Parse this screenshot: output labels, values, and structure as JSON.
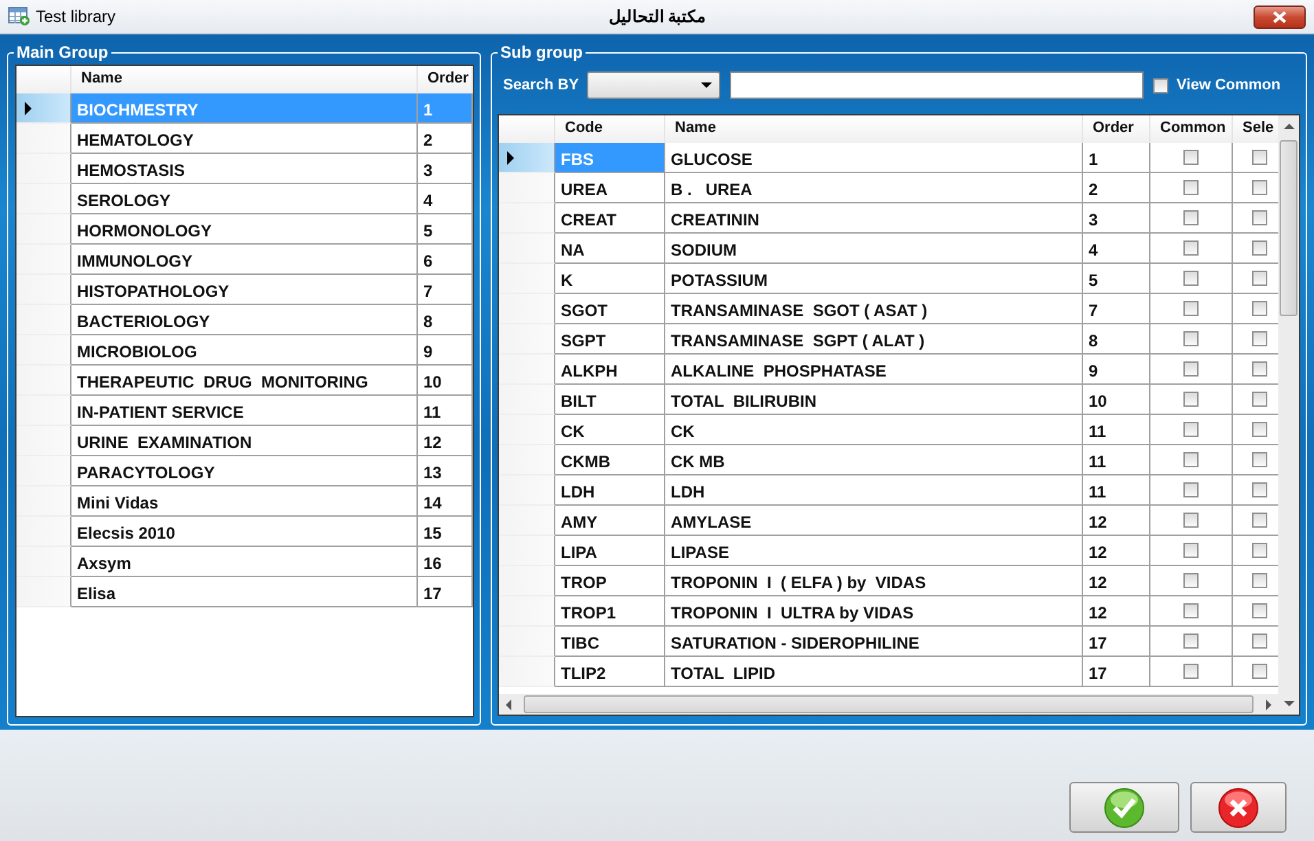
{
  "window": {
    "title": "Test library",
    "caption": "مكتبة التحاليل"
  },
  "main_group": {
    "title": "Main Group",
    "columns": [
      "Name",
      "Order"
    ],
    "rows": [
      {
        "name": "BIOCHMESTRY",
        "order": "1",
        "selected": true
      },
      {
        "name": "HEMATOLOGY",
        "order": "2",
        "selected": false
      },
      {
        "name": "HEMOSTASIS",
        "order": "3",
        "selected": false
      },
      {
        "name": "SEROLOGY",
        "order": "4",
        "selected": false
      },
      {
        "name": "HORMONOLOGY",
        "order": "5",
        "selected": false
      },
      {
        "name": "IMMUNOLOGY",
        "order": "6",
        "selected": false
      },
      {
        "name": "HISTOPATHOLOGY",
        "order": "7",
        "selected": false
      },
      {
        "name": "BACTERIOLOGY",
        "order": "8",
        "selected": false
      },
      {
        "name": "MICROBIOLOG",
        "order": "9",
        "selected": false
      },
      {
        "name": "THERAPEUTIC  DRUG  MONITORING",
        "order": "10",
        "selected": false
      },
      {
        "name": "IN-PATIENT SERVICE",
        "order": "11",
        "selected": false
      },
      {
        "name": "URINE  EXAMINATION",
        "order": "12",
        "selected": false
      },
      {
        "name": "PARACYTOLOGY",
        "order": "13",
        "selected": false
      },
      {
        "name": "Mini Vidas",
        "order": "14",
        "selected": false
      },
      {
        "name": "Elecsis 2010",
        "order": "15",
        "selected": false
      },
      {
        "name": "Axsym",
        "order": "16",
        "selected": false
      },
      {
        "name": "Elisa",
        "order": "17",
        "selected": false
      }
    ]
  },
  "sub_group": {
    "title": "Sub group",
    "search_label": "Search BY",
    "view_common": {
      "label": "View Common",
      "checked": false
    },
    "columns": [
      "Code",
      "Name",
      "Order",
      "Common",
      "Sele"
    ],
    "rows": [
      {
        "code": "FBS",
        "name": "GLUCOSE",
        "order": "1",
        "common": false,
        "select": false,
        "selected": true
      },
      {
        "code": "UREA",
        "name": "B .   UREA",
        "order": "2",
        "common": false,
        "select": false,
        "selected": false
      },
      {
        "code": "CREAT",
        "name": "CREATININ",
        "order": "3",
        "common": false,
        "select": false,
        "selected": false
      },
      {
        "code": "NA",
        "name": "SODIUM",
        "order": "4",
        "common": false,
        "select": false,
        "selected": false
      },
      {
        "code": "K",
        "name": "POTASSIUM",
        "order": "5",
        "common": false,
        "select": false,
        "selected": false
      },
      {
        "code": "SGOT",
        "name": "TRANSAMINASE  SGOT ( ASAT )",
        "order": "7",
        "common": false,
        "select": false,
        "selected": false
      },
      {
        "code": "SGPT",
        "name": "TRANSAMINASE  SGPT ( ALAT )",
        "order": "8",
        "common": false,
        "select": false,
        "selected": false
      },
      {
        "code": "ALKPH",
        "name": "ALKALINE  PHOSPHATASE",
        "order": "9",
        "common": false,
        "select": false,
        "selected": false
      },
      {
        "code": "BILT",
        "name": "TOTAL  BILIRUBIN",
        "order": "10",
        "common": false,
        "select": false,
        "selected": false
      },
      {
        "code": "CK",
        "name": "CK",
        "order": "11",
        "common": false,
        "select": false,
        "selected": false
      },
      {
        "code": "CKMB",
        "name": "CK MB",
        "order": "11",
        "common": false,
        "select": false,
        "selected": false
      },
      {
        "code": "LDH",
        "name": "LDH",
        "order": "11",
        "common": false,
        "select": false,
        "selected": false
      },
      {
        "code": "AMY",
        "name": "AMYLASE",
        "order": "12",
        "common": false,
        "select": false,
        "selected": false
      },
      {
        "code": "LIPA",
        "name": "LIPASE",
        "order": "12",
        "common": false,
        "select": false,
        "selected": false
      },
      {
        "code": "TROP",
        "name": "TROPONIN  I  ( ELFA ) by  VIDAS",
        "order": "12",
        "common": false,
        "select": false,
        "selected": false
      },
      {
        "code": "TROP1",
        "name": "TROPONIN  I  ULTRA by VIDAS",
        "order": "12",
        "common": false,
        "select": false,
        "selected": false
      },
      {
        "code": "TIBC",
        "name": "SATURATION - SIDEROPHILINE",
        "order": "17",
        "common": false,
        "select": false,
        "selected": false
      },
      {
        "code": "TLIP2",
        "name": "TOTAL  LIPID",
        "order": "17",
        "common": false,
        "select": false,
        "selected": false
      }
    ]
  },
  "buttons": [
    {
      "kind": "ok"
    },
    {
      "kind": "cancel"
    }
  ]
}
